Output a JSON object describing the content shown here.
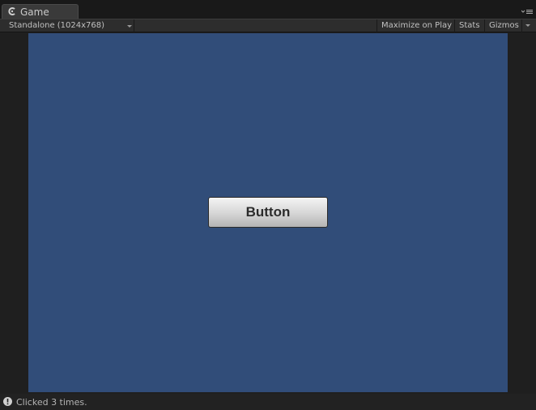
{
  "tab": {
    "title": "Game",
    "icon": "unity-game-icon"
  },
  "toolbar": {
    "resolution": "Standalone (1024x768)",
    "maximize_on_play": "Maximize on Play",
    "stats": "Stats",
    "gizmos": "Gizmos"
  },
  "game": {
    "button_label": "Button",
    "background": "#314d79"
  },
  "status": {
    "message": "Clicked 3 times.",
    "icon": "info-icon"
  }
}
